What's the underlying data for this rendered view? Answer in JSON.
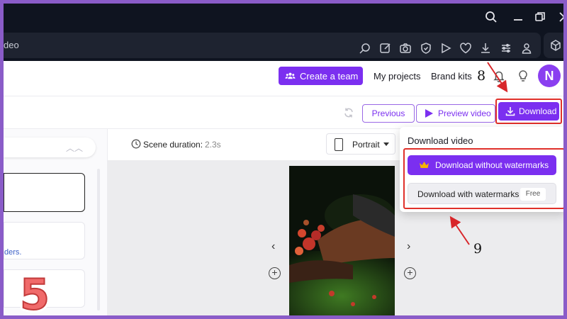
{
  "browser": {
    "address_partial": "deo",
    "toolbar_icons": [
      "zoom-icon",
      "edit-icon",
      "camera-icon",
      "shield-icon",
      "play-icon",
      "heart-icon",
      "download-icon",
      "sliders-icon",
      "person-icon",
      "cube-icon"
    ]
  },
  "appnav": {
    "create_team_label": "Create a team",
    "my_projects_label": "My projects",
    "brand_kits_label": "Brand kits",
    "avatar_initial": "N"
  },
  "editor": {
    "previous_label": "Previous",
    "preview_label": "Preview video",
    "download_label": "Download"
  },
  "left_panel": {
    "link_fragment": "ders."
  },
  "canvas": {
    "scene_duration_label": "Scene duration:",
    "scene_duration_value": "2.3s",
    "orientation_label": "Portrait"
  },
  "download_menu": {
    "title": "Download video",
    "no_watermark_label": "Download without watermarks",
    "watermark_label": "Download with watermarks",
    "free_badge": "Free"
  },
  "annotations": {
    "step_8": "8",
    "step_9": "9"
  },
  "logo": {
    "digit": "5"
  },
  "colors": {
    "accent": "#7b2ff0",
    "highlight": "#e0302a",
    "frame": "#8a5cc8"
  }
}
